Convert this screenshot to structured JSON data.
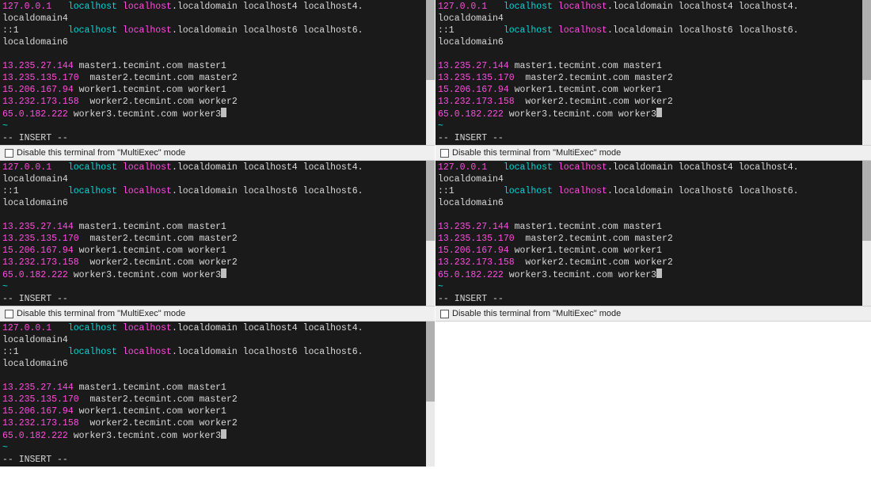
{
  "colors": {
    "bg": "#1a1a1a",
    "fg": "#d0d0d0",
    "magenta": "#ff4bdf",
    "cyan": "#00d9d9"
  },
  "toolbar": {
    "disable_label": "Disable this terminal from \"MultiExec\" mode"
  },
  "terminal": {
    "lines": [
      {
        "segments": [
          {
            "t": "127.0.0.1   ",
            "c": "magenta"
          },
          {
            "t": "localhost ",
            "c": "cyan"
          },
          {
            "t": "localhost",
            "c": "magenta"
          },
          {
            "t": ".localdomain localhost4 localhost4.",
            "c": "white"
          }
        ]
      },
      {
        "segments": [
          {
            "t": "localdomain4",
            "c": "white"
          }
        ]
      },
      {
        "segments": [
          {
            "t": "::1         ",
            "c": "white"
          },
          {
            "t": "localhost ",
            "c": "cyan"
          },
          {
            "t": "localhost",
            "c": "magenta"
          },
          {
            "t": ".localdomain localhost6 localhost6.",
            "c": "white"
          }
        ]
      },
      {
        "segments": [
          {
            "t": "localdomain6",
            "c": "white"
          }
        ]
      },
      {
        "segments": []
      },
      {
        "segments": [
          {
            "t": "13.235.27.144",
            "c": "magenta"
          },
          {
            "t": " master1.tecmint.com master1",
            "c": "white"
          }
        ]
      },
      {
        "segments": [
          {
            "t": "13.235.135.170",
            "c": "magenta"
          },
          {
            "t": "  master2.tecmint.com master2",
            "c": "white"
          }
        ]
      },
      {
        "segments": [
          {
            "t": "15.206.167.94",
            "c": "magenta"
          },
          {
            "t": " worker1.tecmint.com worker1",
            "c": "white"
          }
        ]
      },
      {
        "segments": [
          {
            "t": "13.232.173.158",
            "c": "magenta"
          },
          {
            "t": "  worker2.tecmint.com worker2",
            "c": "white"
          }
        ]
      },
      {
        "segments": [
          {
            "t": "65.0.182.222",
            "c": "magenta"
          },
          {
            "t": " worker3.tecmint.com worker3",
            "c": "white"
          }
        ],
        "cursor": true
      },
      {
        "segments": [
          {
            "t": "~",
            "c": "tilde"
          }
        ]
      },
      {
        "segments": [
          {
            "t": "-- INSERT --",
            "c": "white"
          }
        ]
      }
    ]
  },
  "panes": [
    {
      "show_toolbar": true
    },
    {
      "show_toolbar": true
    },
    {
      "show_toolbar": true
    },
    {
      "show_toolbar": true
    },
    {
      "show_toolbar": false
    },
    {
      "empty": true
    }
  ]
}
